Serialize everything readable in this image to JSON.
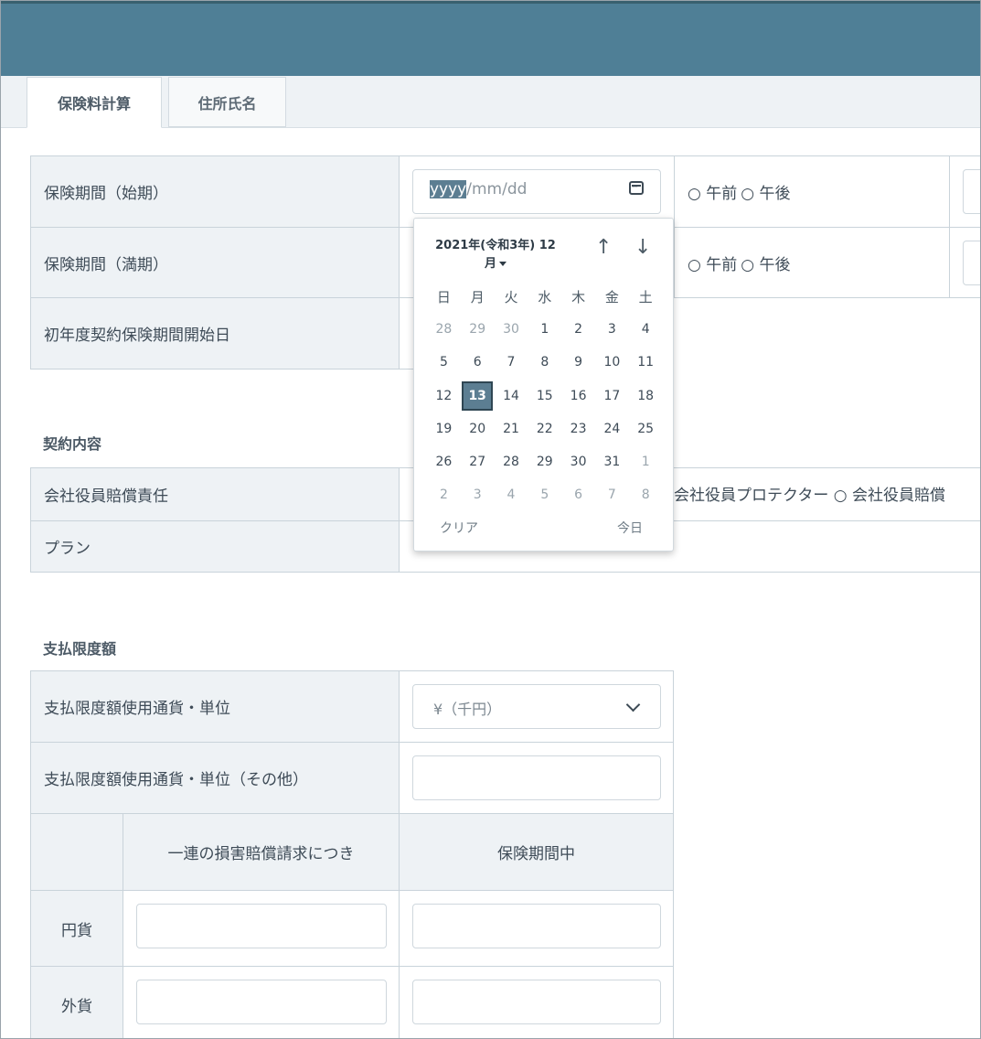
{
  "tabs": [
    {
      "label": "保険料計算"
    },
    {
      "label": "住所氏名"
    }
  ],
  "period": {
    "start_label": "保険期間（始期）",
    "end_label": "保険期間（満期）",
    "first_year_label": "初年度契約保険期間開始日",
    "date_placeholder_year": "yyyy",
    "date_placeholder_rest": "/mm/dd",
    "am_option": "○ 午前",
    "pm_option": "○ 午後"
  },
  "contract": {
    "section_title": "契約内容",
    "directors_label": "会社役員賠償責任",
    "directors_value": "会社役員プロテクター ○ 会社役員賠償",
    "plan_label": "プラン"
  },
  "limits": {
    "section_title": "支払限度額",
    "currency_label": "支払限度額使用通貨・単位",
    "currency_value": "¥（千円）",
    "currency_other_label": "支払限度額使用通貨・単位（その他）",
    "col_per_claim": "一連の損害賠償請求につき",
    "col_period": "保険期間中",
    "row_jpy": "円貨",
    "row_foreign": "外貨"
  },
  "datepicker": {
    "title_line1": "2021年(令和3年) 12",
    "title_line2": "月",
    "prev_label": "↑",
    "next_label": "↓",
    "weekdays": [
      "日",
      "月",
      "火",
      "水",
      "木",
      "金",
      "土"
    ],
    "weeks": [
      [
        "28",
        "29",
        "30",
        "1",
        "2",
        "3",
        "4"
      ],
      [
        "5",
        "6",
        "7",
        "8",
        "9",
        "10",
        "11"
      ],
      [
        "12",
        "13",
        "14",
        "15",
        "16",
        "17",
        "18"
      ],
      [
        "19",
        "20",
        "21",
        "22",
        "23",
        "24",
        "25"
      ],
      [
        "26",
        "27",
        "28",
        "29",
        "30",
        "31",
        "1"
      ],
      [
        "2",
        "3",
        "4",
        "5",
        "6",
        "7",
        "8"
      ]
    ],
    "selected_day": "13",
    "clear_label": "クリア",
    "today_label": "今日"
  }
}
